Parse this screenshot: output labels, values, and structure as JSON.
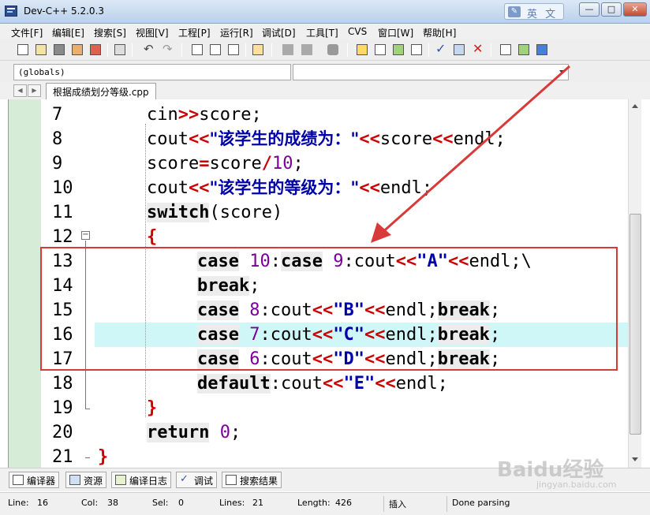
{
  "window": {
    "title": "Dev-C++ 5.2.0.3",
    "ime_label": "英 文",
    "min_label": "—",
    "max_label": "□",
    "close_label": "✕"
  },
  "menu": [
    "文件[F]",
    "编辑[E]",
    "搜索[S]",
    "视图[V]",
    "工程[P]",
    "运行[R]",
    "调试[D]",
    "工具[T]",
    "CVS",
    "窗口[W]",
    "帮助[H]"
  ],
  "toolbar_icons": [
    "new-file-icon",
    "open-file-icon",
    "save-icon",
    "save-all-icon",
    "close-file-icon",
    "print-icon",
    "undo-icon",
    "redo-icon",
    "find-icon",
    "replace-icon",
    "find-next-icon",
    "goto-line-icon",
    "bookmark-icon",
    "bookmark-next-icon",
    "compile-icon",
    "compile-run-icon",
    "run-icon",
    "rebuild-icon",
    "debug-icon",
    "check-icon",
    "chart-icon",
    "delete-icon",
    "new-project-icon",
    "add-to-project-icon",
    "options-icon"
  ],
  "combo": {
    "scope_value": "(globals)",
    "function_value": ""
  },
  "file_tab": "根据成绩划分等级.cpp",
  "code_lines": [
    {
      "num": "7",
      "text": "cin>>score;"
    },
    {
      "num": "8",
      "text": "cout<<\"该学生的成绩为：\"<<score<<endl;"
    },
    {
      "num": "9",
      "text": "score=score/10;"
    },
    {
      "num": "10",
      "text": "cout<<\"该学生的等级为：\"<<endl;"
    },
    {
      "num": "11",
      "text": "switch(score)"
    },
    {
      "num": "12",
      "text": "{"
    },
    {
      "num": "13",
      "text": "case 10:case 9:cout<<\"A\"<<endl;\\"
    },
    {
      "num": "14",
      "text": "break;"
    },
    {
      "num": "15",
      "text": "case 8:cout<<\"B\"<<endl;break;"
    },
    {
      "num": "16",
      "text": "case 7:cout<<\"C\"<<endl;break;"
    },
    {
      "num": "17",
      "text": "case 6:cout<<\"D\"<<endl;break;"
    },
    {
      "num": "18",
      "text": "default:cout<<\"E\"<<endl;"
    },
    {
      "num": "19",
      "text": "}"
    },
    {
      "num": "20",
      "text": "return 0;"
    },
    {
      "num": "21",
      "text": "}"
    }
  ],
  "active_line": "16",
  "bottom_tabs": [
    "编译器",
    "资源",
    "编译日志",
    "调试",
    "搜索结果"
  ],
  "status": {
    "line_label": "Line:",
    "line_value": "16",
    "col_label": "Col:",
    "col_value": "38",
    "sel_label": "Sel:",
    "sel_value": "0",
    "lines_label": "Lines:",
    "lines_value": "21",
    "length_label": "Length:",
    "length_value": "426",
    "mode": "插入",
    "message": "Done parsing"
  },
  "watermark": "Baidu经验",
  "watermark_sub": "jingyan.baidu.com",
  "colors": {
    "keyword": "#000000",
    "operator": "#cc0000",
    "string": "#0000aa",
    "number": "#7a0099",
    "active_line_bg": "#cff7f7",
    "annotation_red": "#d83a3a",
    "margin_green": "#d7ecd7"
  }
}
